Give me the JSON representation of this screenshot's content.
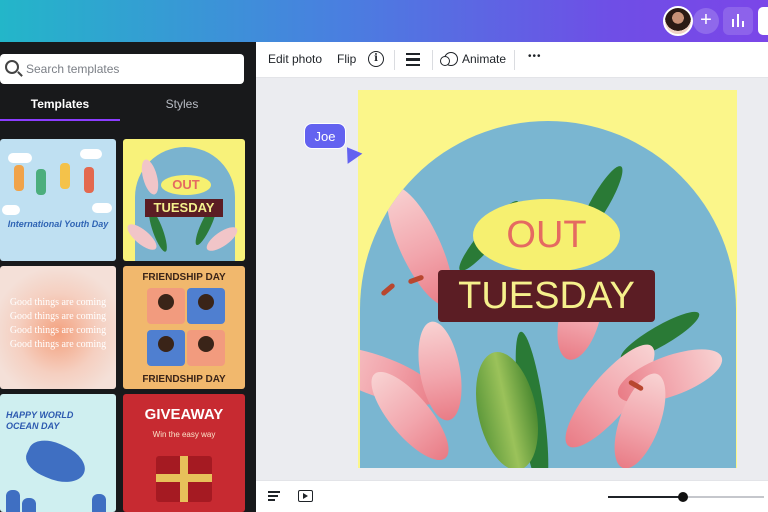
{
  "panel": {
    "search_placeholder": "Search templates",
    "tabs": [
      {
        "label": "Templates",
        "active": true
      },
      {
        "label": "Styles",
        "active": false
      }
    ],
    "templates": [
      {
        "caption": "International Youth Day"
      },
      {
        "pill": "OUT",
        "tag": "TUESDAY"
      },
      {
        "lines": [
          "Good things are coming",
          "Good things are coming",
          "Good things are coming",
          "Good things are coming"
        ]
      },
      {
        "band": "FRIENDSHIP DAY"
      },
      {
        "title": "HAPPY WORLD OCEAN DAY"
      },
      {
        "title": "GIVEAWAY",
        "subtitle": "Win the easy way"
      }
    ]
  },
  "toolbar": {
    "edit_photo": "Edit photo",
    "flip": "Flip",
    "info_glyph": "i",
    "animate": "Animate",
    "more": "•••"
  },
  "canvas": {
    "pill_text": "OUT",
    "tag_text": "TUESDAY",
    "collaborator": "Joe"
  },
  "topbar": {
    "plus": "+"
  },
  "zoom": {
    "level": 0.48
  },
  "colors": {
    "accent": "#8b3dff",
    "artboard_bg": "#fbf68a",
    "arch": "#7ab6d1",
    "tag_bg": "#5b1d24",
    "tag_text": "#f6f08c",
    "pill_bg": "#f6f070",
    "pill_text": "#e56a61",
    "collaborator": "#6362f0"
  },
  "icons": [
    "search-icon",
    "info-icon",
    "position-icon",
    "animate-icon",
    "more-icon",
    "notes-icon",
    "present-icon",
    "analytics-icon",
    "add-icon"
  ]
}
